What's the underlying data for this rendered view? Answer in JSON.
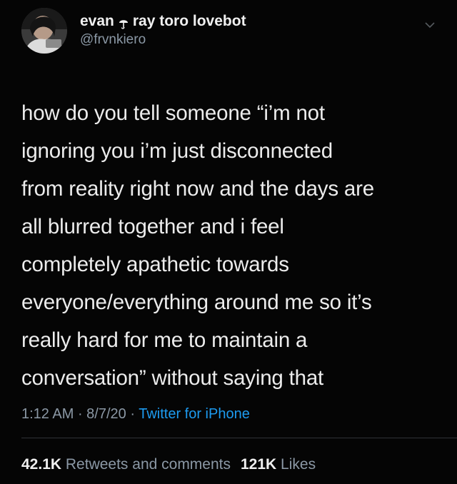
{
  "author": {
    "display_name_left": "evan",
    "display_name_right": "ray toro lovebot",
    "handle": "@frvnkiero",
    "name_icon": "umbrella-icon"
  },
  "tweet": {
    "lines": [
      "how do you tell someone “i’m not",
      "ignoring you i’m just disconnected",
      "from reality right now and the days are",
      "all blurred together and i feel",
      "completely apathetic towards",
      "everyone/everything around me so it’s",
      "really hard for me to maintain a",
      "conversation” without saying that"
    ]
  },
  "meta": {
    "time": "1:12 AM",
    "separator": " · ",
    "date": "8/7/20",
    "source": "Twitter for iPhone"
  },
  "stats": {
    "retweets_count": "42.1K",
    "retweets_label": "Retweets and comments",
    "likes_count": "121K",
    "likes_label": "Likes"
  },
  "colors": {
    "background": "#050505",
    "text": "#ececec",
    "muted": "#8b98a5",
    "link": "#1d9bf0"
  },
  "icons": {
    "menu": "chevron-down-icon"
  }
}
